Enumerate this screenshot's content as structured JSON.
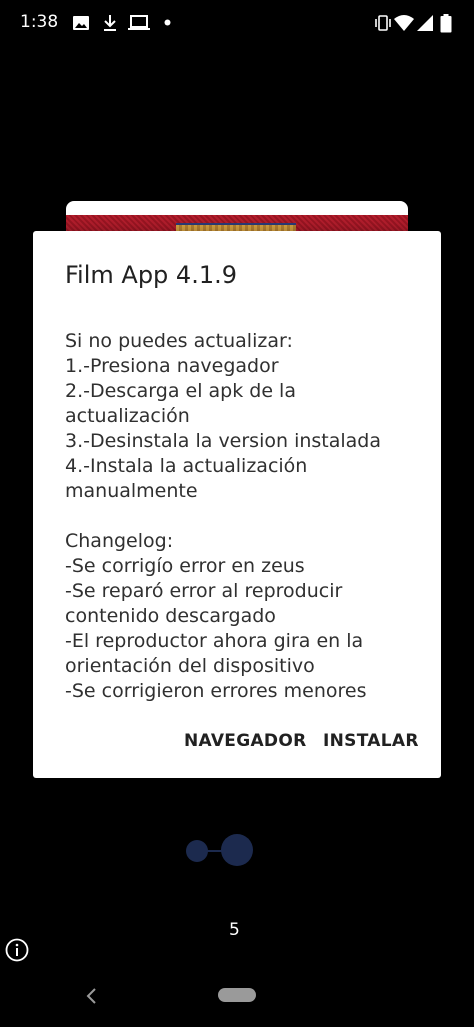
{
  "status_bar": {
    "time": "1:38",
    "left_icons": [
      "image-icon",
      "download-icon",
      "laptop-icon",
      "dot-icon"
    ],
    "right_icons": [
      "vibrate-icon",
      "wifi-icon",
      "signal-icon",
      "battery-icon"
    ]
  },
  "dialog": {
    "title": "Film App 4.1.9",
    "body": "Si no puedes actualizar:\n1.-Presiona navegador\n2.-Descarga el apk de la actualización\n3.-Desinstala la version instalada\n4.-Instala la actualización manualmente\n\nChangelog:\n-Se corrigío error en zeus\n-Se reparó error al reproducir contenido descargado\n-El reproductor ahora gira en la orientación del dispositivo\n-Se corrigieron errores menores",
    "buttons": {
      "navegador": "NAVEGADOR",
      "instalar": "INSTALAR"
    }
  },
  "pager": {
    "page_number": "5"
  },
  "colors": {
    "background": "#000000",
    "dialog": "#ffffff",
    "dots": "#1c2a4e"
  }
}
